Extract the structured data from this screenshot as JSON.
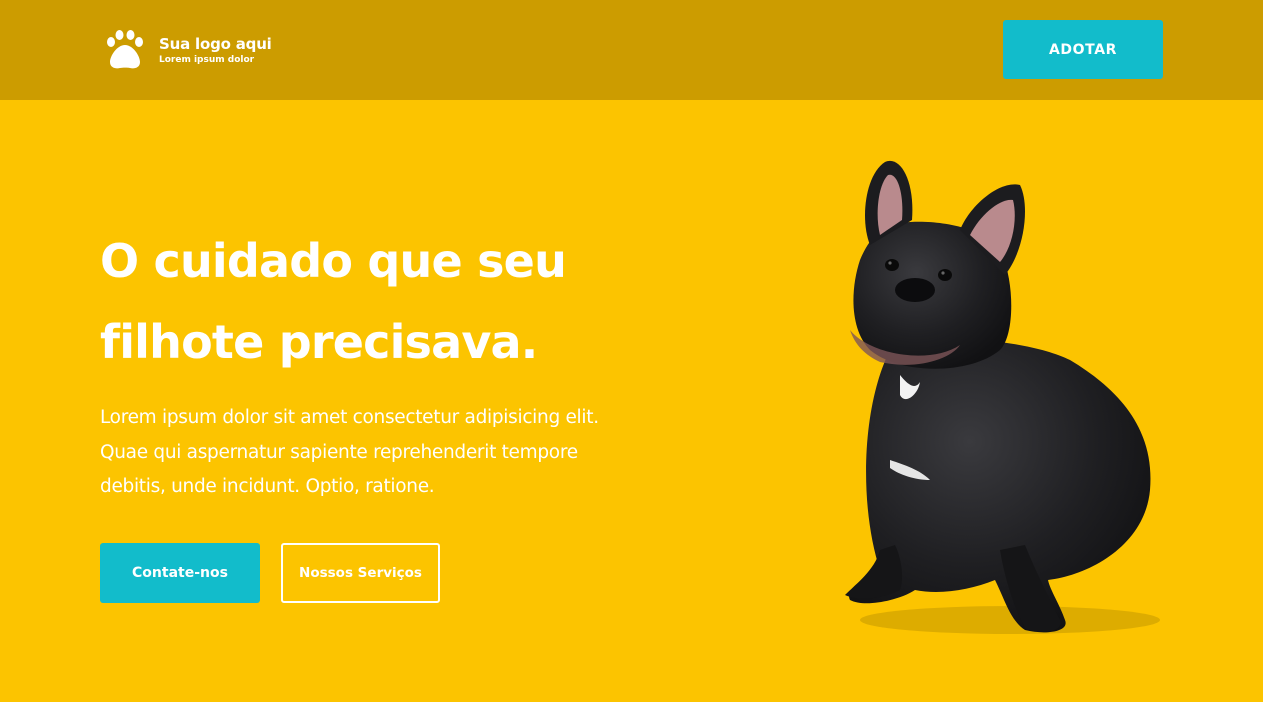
{
  "header": {
    "logo_icon": "paw-icon",
    "logo_title": "Sua logo aqui",
    "logo_subtitle": "Lorem ipsum dolor",
    "adopt_label": "ADOTAR"
  },
  "hero": {
    "title_line1": "O cuidado que seu",
    "title_line2": "filhote precisava.",
    "text_line1": "Lorem ipsum dolor sit amet consectetur adipisicing elit.",
    "text_line2": "Quae qui aspernatur sapiente reprehenderit tempore",
    "text_line3": "debitis, unde incidunt. Optio, ratione.",
    "primary_cta": "Contate-nos",
    "secondary_cta": "Nossos Serviços",
    "image": "french-bulldog-photo"
  },
  "colors": {
    "background": "#fcc400",
    "header": "#cc9c00",
    "accent": "#12bccb",
    "text": "#ffffff"
  }
}
